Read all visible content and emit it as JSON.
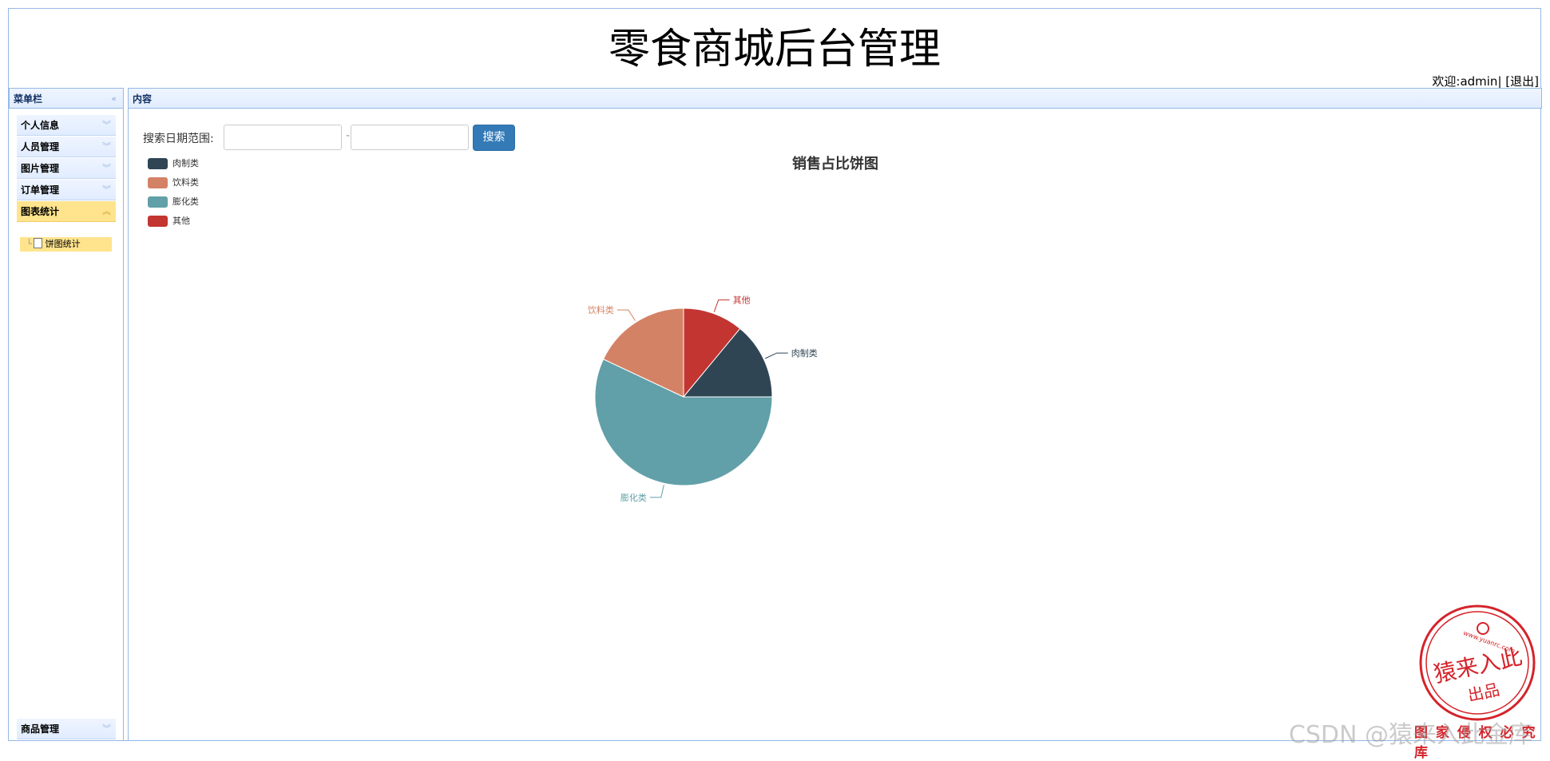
{
  "header": {
    "title": "零食商城后台管理",
    "welcome_prefix": "欢迎:",
    "username": "admin",
    "separator": "|",
    "logout": "[退出]"
  },
  "sidebar": {
    "title": "菜单栏",
    "items": [
      {
        "label": "个人信息",
        "expanded": false
      },
      {
        "label": "人员管理",
        "expanded": false
      },
      {
        "label": "图片管理",
        "expanded": false
      },
      {
        "label": "订单管理",
        "expanded": false
      },
      {
        "label": "图表统计",
        "expanded": true
      },
      {
        "label": "商品管理",
        "expanded": false
      }
    ],
    "sub_item": {
      "label": "饼图统计"
    }
  },
  "content": {
    "title": "内容",
    "search": {
      "label": "搜索日期范围:",
      "start_value": "",
      "end_value": "",
      "dash": "-",
      "button": "搜索"
    }
  },
  "chart_data": {
    "type": "pie",
    "title": "销售占比饼图",
    "legend_position": "top-left",
    "categories": [
      "肉制类",
      "饮料类",
      "膨化类",
      "其他"
    ],
    "values": [
      14,
      18,
      57,
      11
    ],
    "colors": [
      "#2f4554",
      "#d48265",
      "#61a0a8",
      "#c23531"
    ]
  },
  "watermark": {
    "text": "CSDN @猿来入此金库",
    "stamp_main": "猿来入此",
    "stamp_sub": "出品",
    "stamp_url": "www.yuanrc.com",
    "stamp_bottom": "图 家 侵 权 必 究 库"
  }
}
